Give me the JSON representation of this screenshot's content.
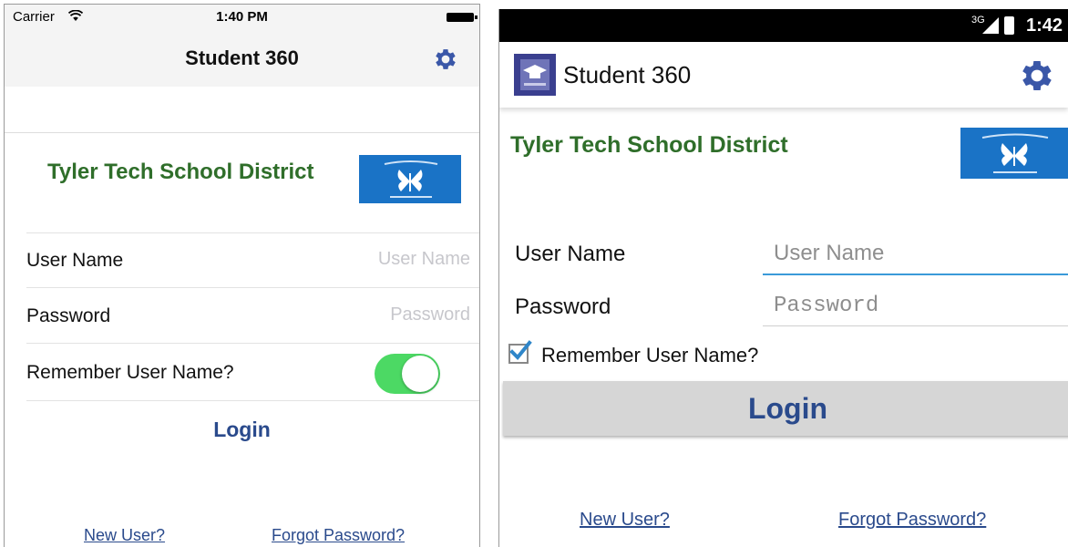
{
  "ios": {
    "status": {
      "carrier": "Carrier",
      "time": "1:40 PM"
    },
    "nav": {
      "title": "Student 360",
      "settings_icon": "gear-icon"
    },
    "district_name": "Tyler Tech School District",
    "form": {
      "username_label": "User Name",
      "username_placeholder": "User Name",
      "password_label": "Password",
      "password_placeholder": "Password",
      "remember_label": "Remember User Name?",
      "remember_on": true
    },
    "login_label": "Login",
    "links": {
      "new_user": "New User?",
      "forgot_password": "Forgot Password?"
    }
  },
  "android": {
    "status": {
      "network": "3G",
      "time": "1:42"
    },
    "toolbar": {
      "title": "Student 360",
      "settings_icon": "gear-icon"
    },
    "district_name": "Tyler Tech School District",
    "form": {
      "username_label": "User Name",
      "username_placeholder": "User Name",
      "password_label": "Password",
      "password_placeholder": "Password",
      "remember_label": "Remember User Name?",
      "remember_checked": true
    },
    "login_label": "Login",
    "links": {
      "new_user": "New User?",
      "forgot_password": "Forgot Password?"
    }
  },
  "colors": {
    "district_green": "#2f6e2a",
    "link_blue": "#2a4a8c",
    "toggle_green": "#4cd964",
    "android_underline": "#3a9ad9",
    "checkbox_blue": "#2f86c9",
    "logo_blue": "#1a73c6"
  }
}
